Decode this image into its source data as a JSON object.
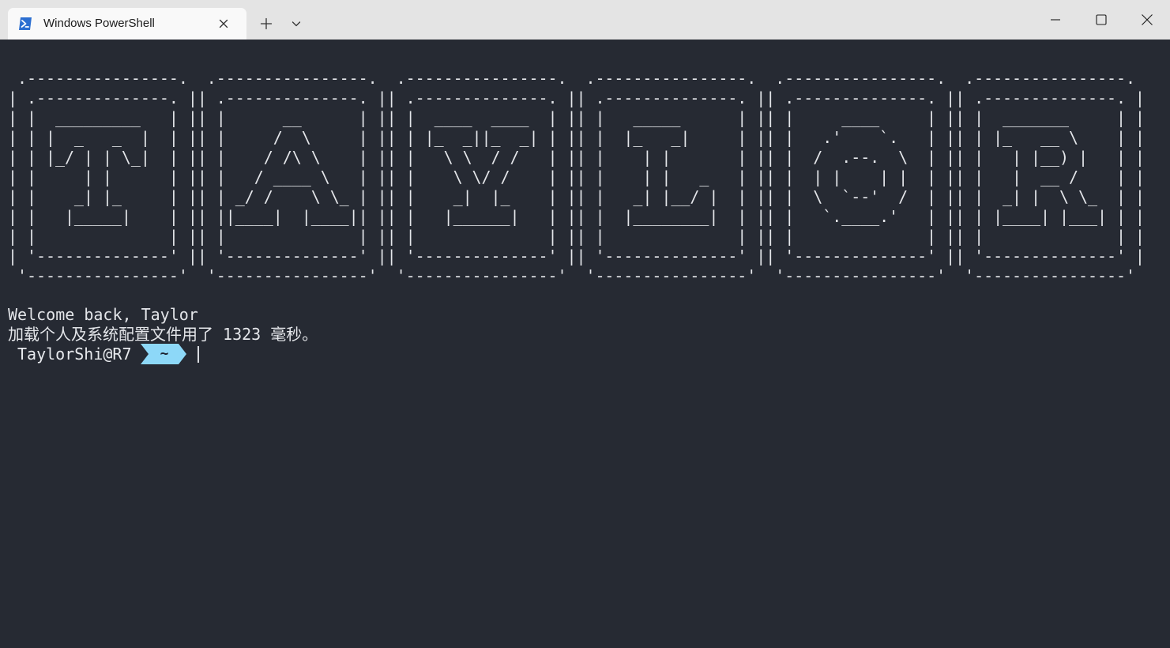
{
  "window": {
    "tab_title": "Windows PowerShell",
    "tab_icon": "powershell-icon",
    "new_tab_icon": "plus-icon",
    "dropdown_icon": "chevron-down-icon",
    "controls": [
      "minimize-icon",
      "maximize-icon",
      "close-icon"
    ]
  },
  "terminal": {
    "ascii_banner": " .----------------.  .----------------.  .----------------.  .----------------.  .----------------.  .----------------. \n| .--------------. || .--------------. || .--------------. || .--------------. || .--------------. || .--------------. |\n| |  _________   | || |      __      | || |  ____  ____  | || |   _____      | || |     ____     | || |  _______     | |\n| | |  _   _  |  | || |     /  \\     | || | |_  _||_  _| | || |  |_   _|     | || |   .'    `.   | || | |_   __ \\    | |\n| | |_/ | | \\_|  | || |    / /\\ \\    | || |   \\ \\  / /   | || |    | |       | || |  /  .--.  \\  | || |   | |__) |   | |\n| |     | |      | || |   / ____ \\   | || |    \\ \\/ /    | || |    | |   _   | || |  | |    | |  | || |   |  __ /    | |\n| |    _| |_     | || | _/ /    \\ \\_ | || |    _|  |_    | || |   _| |__/ |  | || |  \\  `--'  /  | || |  _| |  \\ \\_  | |\n| |   |_____|    | || ||____|  |____|| || |   |______|   | || |  |________|  | || |   `.____.'   | || | |____| |___| | |\n| |              | || |              | || |              | || |              | || |              | || |              | |\n| '--------------' || '--------------' || '--------------' || '--------------' || '--------------' || '--------------' |\n '----------------'  '----------------'  '----------------'  '----------------'  '----------------'  '----------------' ",
    "welcome_line": "Welcome back, Taylor",
    "load_line": "加载个人及系统配置文件用了 1323 毫秒。",
    "prompt_user": "TaylorShi@R7",
    "prompt_dir": "~"
  },
  "colors": {
    "terminal_bg": "#262a33",
    "titlebar_bg": "#e4e4e4",
    "tab_bg": "#f9f9f9",
    "text": "#e4e6ea",
    "prompt_segment": "#8dd8f8",
    "powershell_blue": "#2c6fd1"
  }
}
